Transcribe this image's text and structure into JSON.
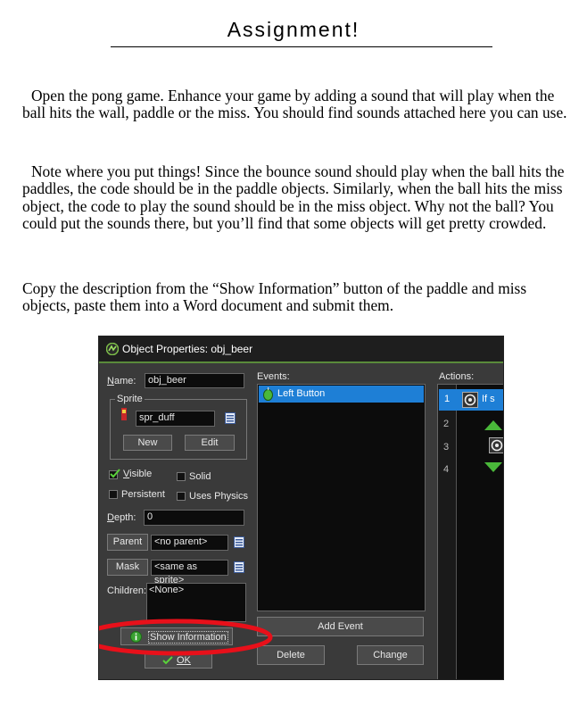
{
  "doc": {
    "title": "Assignment!",
    "paragraphs": [
      "Open the pong game.  Enhance your game by adding a sound that will play when the ball hits the wall, paddle or the miss.  You should find sounds attached here you can use.",
      "Note where you put things!  Since the bounce sound should play when the ball hits the paddles, the code should be in the paddle objects.  Similarly, when the ball hits the miss object, the code to play the sound should be in the miss object.  Why not the ball?  You could put the sounds there, but you’ll find that some objects will get pretty crowded.",
      "Copy the description from the “Show Information” button of the paddle and miss objects, paste them into a Word document and submit them."
    ]
  },
  "dialog": {
    "title": "Object Properties: obj_beer",
    "name_label": "Name:",
    "name_value": "obj_beer",
    "sprite_group": "Sprite",
    "sprite_value": "spr_duff",
    "new_label": "New",
    "edit_label": "Edit",
    "visible_label": "Visible",
    "solid_label": "Solid",
    "persistent_label": "Persistent",
    "uses_physics_label": "Uses Physics",
    "depth_label": "Depth:",
    "depth_value": "0",
    "parent_label": "Parent",
    "parent_value": "<no parent>",
    "mask_label": "Mask",
    "mask_value": "<same as sprite>",
    "children_label": "Children:",
    "children_value": "<None>",
    "show_info_label": "Show Information",
    "ok_label": "OK",
    "events_label": "Events:",
    "event_item": "Left Button",
    "add_event_label": "Add Event",
    "delete_label": "Delete",
    "change_label": "Change",
    "actions_label": "Actions:",
    "action_rows": [
      "1",
      "2",
      "3",
      "4"
    ],
    "action_first_text": "If s"
  },
  "colors": {
    "highlight_ellipse": "#e8101a",
    "selection": "#1e7fd6",
    "accent_green": "#5aa832"
  }
}
